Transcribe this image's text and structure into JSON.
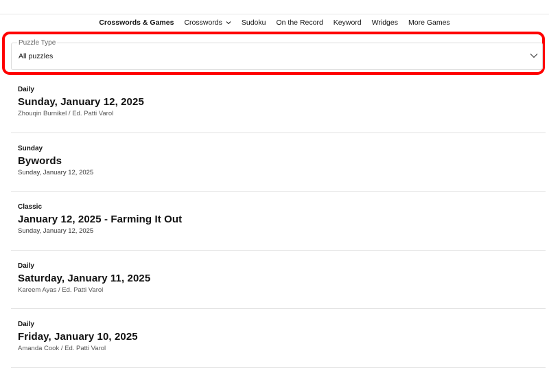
{
  "nav": {
    "items": [
      {
        "label": "Crosswords & Games",
        "active": true
      },
      {
        "label": "Crosswords",
        "has_dropdown": true
      },
      {
        "label": "Sudoku"
      },
      {
        "label": "On the Record"
      },
      {
        "label": "Keyword"
      },
      {
        "label": "Wridges"
      },
      {
        "label": "More Games"
      }
    ]
  },
  "filter": {
    "label": "Puzzle Type",
    "value": "All puzzles",
    "highlight_color": "#ff0000"
  },
  "puzzles": [
    {
      "type": "Daily",
      "title": "Sunday, January 12, 2025",
      "meta": "Zhouqin Burnikel / Ed. Patti Varol"
    },
    {
      "type": "Sunday",
      "title": "Bywords",
      "meta": "Sunday, January 12, 2025"
    },
    {
      "type": "Classic",
      "title": "January 12, 2025 - Farming It Out",
      "meta": "Sunday, January 12, 2025"
    },
    {
      "type": "Daily",
      "title": "Saturday, January 11, 2025",
      "meta": "Kareem Ayas / Ed. Patti Varol"
    },
    {
      "type": "Daily",
      "title": "Friday, January 10, 2025",
      "meta": "Amanda Cook / Ed. Patti Varol"
    }
  ]
}
